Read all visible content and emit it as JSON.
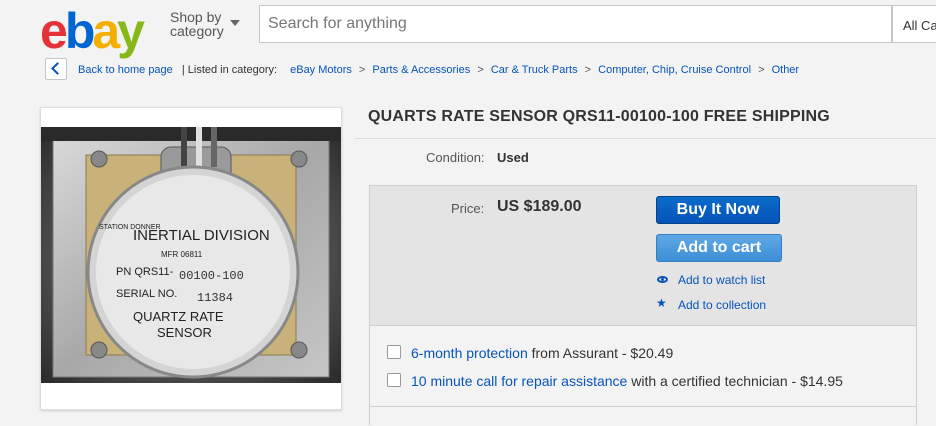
{
  "header": {
    "logo_letters": [
      "e",
      "b",
      "a",
      "y"
    ],
    "shop_by_line1": "Shop by",
    "shop_by_line2": "category",
    "search_placeholder": "Search for anything",
    "category_select": "All Cat"
  },
  "breadcrumb": {
    "back_label": "Back to home page",
    "listed_in": "| Listed in category:",
    "items": [
      "eBay Motors",
      "Parts & Accessories",
      "Car & Truck Parts",
      "Computer, Chip, Cruise Control",
      "Other"
    ],
    "separator": ">"
  },
  "photo": {
    "label_lines": [
      "STATION DONNER",
      "INERTIAL DIVISION",
      "MFR 06811",
      "PN QRS11-",
      "00100-100",
      "SERIAL NO.",
      "11384",
      "QUARTZ RATE",
      "SENSOR"
    ]
  },
  "item": {
    "title": "QUARTS RATE SENSOR QRS11-00100-100 FREE SHIPPING",
    "condition_label": "Condition:",
    "condition_value": "Used",
    "price_label": "Price:",
    "price_value": "US $189.00",
    "buy_now": "Buy It Now",
    "add_to_cart": "Add to cart",
    "watch_list": "Add to watch list",
    "collection": "Add to collection"
  },
  "protection": [
    {
      "link": "6-month protection",
      "rest": " from Assurant - $20.49"
    },
    {
      "link": "10 minute call for repair assistance",
      "rest": " with a certified technician - $14.95"
    }
  ],
  "colors": {
    "accent": "#0654ba",
    "buy_now": "#0654ba",
    "add_to_cart": "#4a9be0"
  }
}
